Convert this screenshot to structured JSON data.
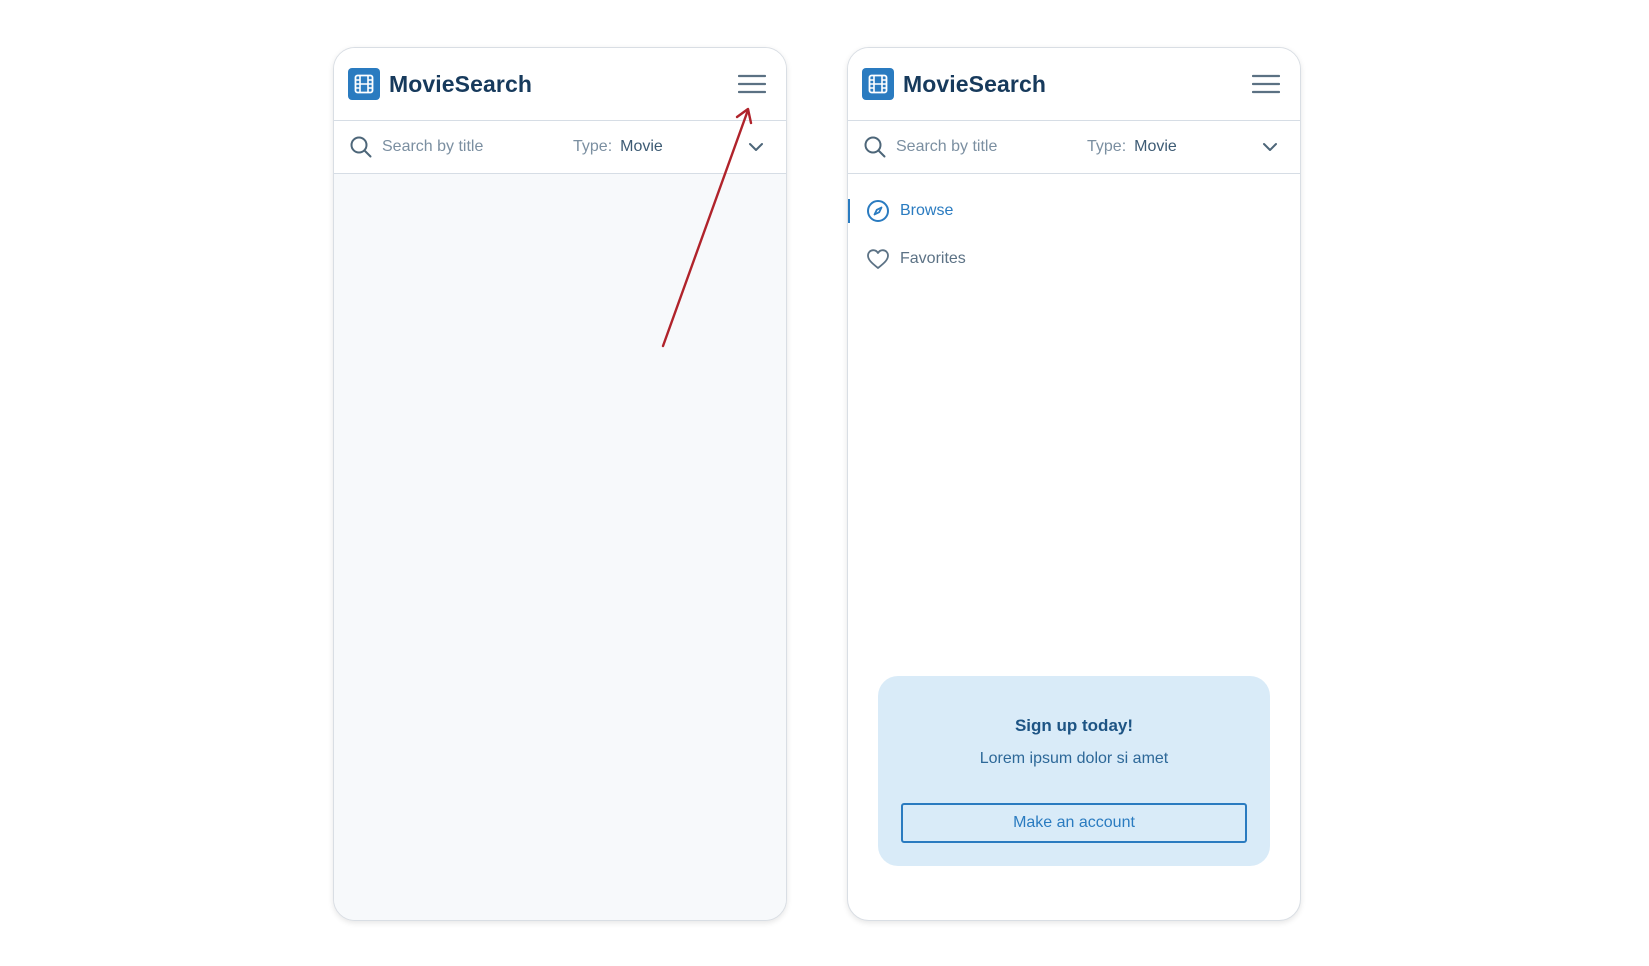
{
  "screens": [
    {
      "id": "menu-closed",
      "brand": {
        "title": "MovieSearch",
        "logo_icon": "film-icon"
      },
      "menu_icon": "hamburger-menu-icon",
      "search": {
        "placeholder": "Search by title",
        "value": ""
      },
      "type_filter": {
        "label": "Type:",
        "value": "Movie"
      }
    },
    {
      "id": "menu-open",
      "brand": {
        "title": "MovieSearch",
        "logo_icon": "film-icon"
      },
      "menu_icon": "hamburger-menu-icon",
      "search": {
        "placeholder": "Search by title",
        "value": ""
      },
      "type_filter": {
        "label": "Type:",
        "value": "Movie"
      },
      "nav": [
        {
          "label": "Browse",
          "icon": "compass-icon",
          "active": true
        },
        {
          "label": "Favorites",
          "icon": "heart-icon",
          "active": false
        }
      ],
      "signup": {
        "title": "Sign up today!",
        "text": "Lorem ipsum dolor si amet",
        "button_label": "Make an account"
      }
    }
  ],
  "colors": {
    "brand_blue": "#2a7bc0",
    "title_navy": "#173a5c",
    "signup_bg": "#d9ebf8",
    "annotation_red": "#b0232b",
    "empty_bg": "#f7f9fb"
  }
}
